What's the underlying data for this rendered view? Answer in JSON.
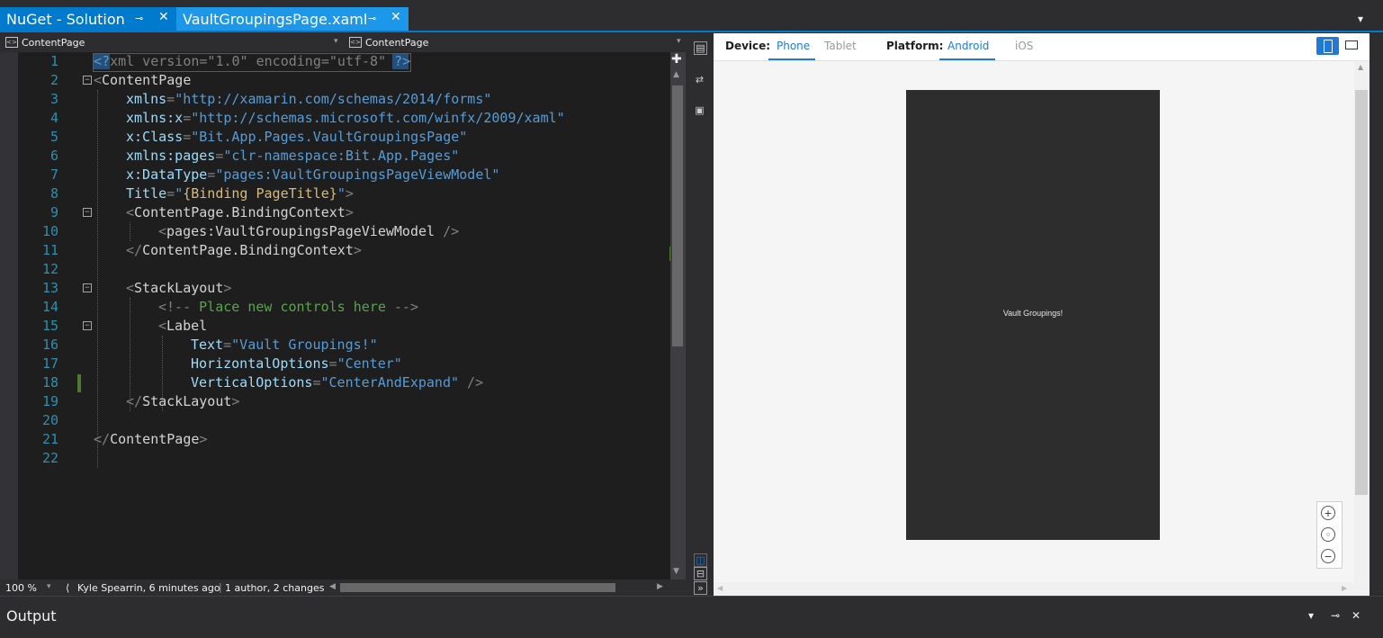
{
  "tabs": [
    {
      "label": "NuGet - Solution",
      "pin": "⊸",
      "close": "✕",
      "active": false
    },
    {
      "label": "VaultGroupingsPage.xaml",
      "pin": "⊸",
      "close": "✕",
      "active": true
    }
  ],
  "navbar": {
    "left_combo": "ContentPage",
    "right_combo": "ContentPage",
    "arrow": "▾"
  },
  "editor": {
    "lines": [
      {
        "n": "1"
      },
      {
        "n": "2"
      },
      {
        "n": "3"
      },
      {
        "n": "4"
      },
      {
        "n": "5"
      },
      {
        "n": "6"
      },
      {
        "n": "7"
      },
      {
        "n": "8"
      },
      {
        "n": "9"
      },
      {
        "n": "10"
      },
      {
        "n": "11"
      },
      {
        "n": "12"
      },
      {
        "n": "13"
      },
      {
        "n": "14"
      },
      {
        "n": "15"
      },
      {
        "n": "16"
      },
      {
        "n": "17"
      },
      {
        "n": "18"
      },
      {
        "n": "19"
      },
      {
        "n": "20"
      },
      {
        "n": "21"
      },
      {
        "n": "22"
      }
    ],
    "tokens": {
      "l1_a": "<?",
      "l1_b": "xml version=\"1.0\" encoding=\"utf-8\" ",
      "l1_c": "?>",
      "l2_a": "<",
      "l2_b": "ContentPage",
      "l3_a": "xmlns",
      "l3_b": "=",
      "l3_c": "\"http://xamarin.com/schemas/2014/forms\"",
      "l4_a": "xmlns:x",
      "l4_b": "=",
      "l4_c": "\"http://schemas.microsoft.com/winfx/2009/xaml\"",
      "l5_a": "x:Class",
      "l5_b": "=",
      "l5_c": "\"Bit.App.Pages.VaultGroupingsPage\"",
      "l6_a": "xmlns:pages",
      "l6_b": "=",
      "l6_c": "\"clr-namespace:Bit.App.Pages\"",
      "l7_a": "x:DataType",
      "l7_b": "=",
      "l7_c": "\"pages:VaultGroupingsPageViewModel\"",
      "l8_a": "Title",
      "l8_b": "=",
      "l8_c": "\"",
      "l8_d": "{Binding PageTitle}",
      "l8_e": "\"",
      "l8_f": ">",
      "l9_a": "<",
      "l9_b": "ContentPage.BindingContext",
      "l9_c": ">",
      "l10_a": "<",
      "l10_b": "pages:VaultGroupingsPageViewModel",
      "l10_c": " />",
      "l11_a": "</",
      "l11_b": "ContentPage.BindingContext",
      "l11_c": ">",
      "l13_a": "<",
      "l13_b": "StackLayout",
      "l13_c": ">",
      "l14_a": "<!--",
      "l14_b": " Place new controls here ",
      "l14_c": "-->",
      "l15_a": "<",
      "l15_b": "Label",
      "l16_a": "Text",
      "l16_b": "=",
      "l16_c": "\"Vault Groupings!\"",
      "l17_a": "HorizontalOptions",
      "l17_b": "=",
      "l17_c": "\"Center\"",
      "l18_a": "VerticalOptions",
      "l18_b": "=",
      "l18_c": "\"CenterAndExpand\"",
      "l18_d": " />",
      "l19_a": "</",
      "l19_b": "StackLayout",
      "l19_c": ">",
      "l21_a": "</",
      "l21_b": "ContentPage",
      "l21_c": ">"
    }
  },
  "status": {
    "zoom": "100 %",
    "blame": "Kyle Spearrin, 6 minutes ago",
    "authors": "1 author, 2 changes"
  },
  "previewer": {
    "device_label": "Device:",
    "device_options": [
      "Phone",
      "Tablet"
    ],
    "device_selected": "Phone",
    "platform_label": "Platform:",
    "platform_options": [
      "Android",
      "iOS"
    ],
    "platform_selected": "Android",
    "preview_text": "Vault Groupings!",
    "zoom_buttons": [
      "zoom-in",
      "zoom-fit",
      "zoom-out"
    ],
    "accent_color": "#1e7ad6"
  },
  "output": {
    "title": "Output",
    "buttons": [
      "▾",
      "⊸",
      "✕"
    ]
  },
  "colors": {
    "tab_active": "#007acc",
    "editor_bg": "#1e1e1e",
    "phone_bg": "#2d2d2d"
  }
}
